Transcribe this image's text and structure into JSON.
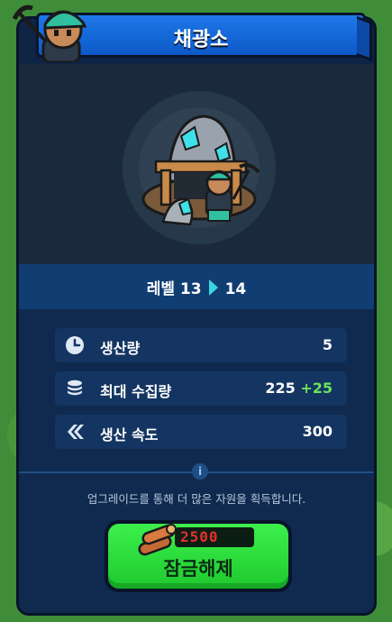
{
  "title": "채광소",
  "level": {
    "prefix": "레벨",
    "from": "13",
    "to": "14"
  },
  "stats": [
    {
      "icon": "clock-icon",
      "label": "생산량",
      "value": "5",
      "bonus": ""
    },
    {
      "icon": "coin-stack-icon",
      "label": "최대 수집량",
      "value": "225",
      "bonus": "+25"
    },
    {
      "icon": "speed-chevrons-icon",
      "label": "생산 속도",
      "value": "300",
      "bonus": ""
    }
  ],
  "info_text": "업그레이드를 통해 더 많은 자원을 획득합니다.",
  "unlock": {
    "cost": "2500",
    "label": "잠금해제"
  },
  "colors": {
    "accent": "#38d7e0",
    "bonus": "#6ce35c",
    "button": "#1ec92e",
    "cost": "#e53030"
  }
}
